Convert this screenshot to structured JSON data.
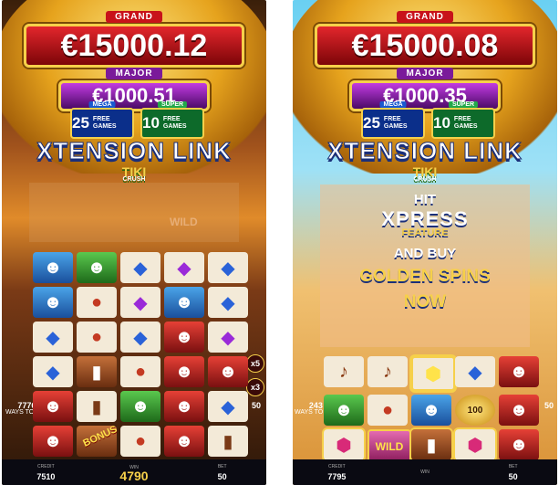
{
  "left": {
    "grand_label": "GRAND",
    "grand_value": "€15000.12",
    "major_label": "MAJOR",
    "major_value": "€1000.51",
    "mega_label": "MEGA",
    "mega_count": "25",
    "mega_text": "FREE GAMES",
    "super_label": "SUPER",
    "super_count": "10",
    "super_text": "FREE GAMES",
    "logo": "XTENSION LINK",
    "sublogo": "TIKI",
    "sublogo_small": "CRUSH",
    "side_value": "7776",
    "side_text": "WAYS TO WIN",
    "mult_x5": "x5",
    "mult_x3": "x3",
    "right_side_value": "50",
    "bonus_text": "BONUS",
    "wild_text": "WILD",
    "credit_label": "CREDIT",
    "credit": "7510",
    "win_label": "WIN",
    "win": "4790",
    "bet_label": "BET",
    "bet": "50"
  },
  "right": {
    "grand_label": "GRAND",
    "grand_value": "€15000.08",
    "major_label": "MAJOR",
    "major_value": "€1000.35",
    "mega_label": "MEGA",
    "mega_count": "25",
    "mega_text": "FREE GAMES",
    "super_label": "SUPER",
    "super_count": "10",
    "super_text": "FREE GAMES",
    "logo": "XTENSION LINK",
    "sublogo": "TIKI",
    "sublogo_small": "CRUSH",
    "promo_hit": "HIT",
    "promo_xpress": "XPRESS",
    "promo_feature": "FEATURE",
    "promo_andbuy": "AND BUY",
    "promo_golden": "GOLDEN SPINS",
    "promo_now": "NOW",
    "side_value": "243",
    "side_text": "WAYS TO WIN",
    "right_side_value": "50",
    "coin_value": "100",
    "wild_text": "WILD",
    "credit_label": "CREDIT",
    "credit": "7795",
    "win_label": "WIN",
    "win": "",
    "bet_label": "BET",
    "bet": "50"
  },
  "colors": {
    "grand": "#c8121a",
    "major": "#7a1a9a",
    "mega": "#0b2f8a",
    "super": "#0d6a2a",
    "gold": "#f6d04a"
  }
}
